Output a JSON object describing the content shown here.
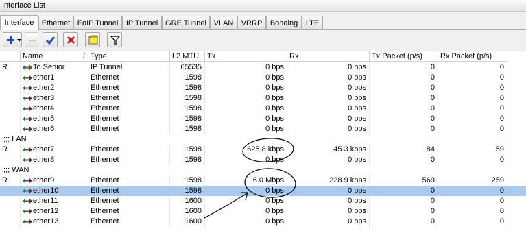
{
  "window": {
    "title": "Interface List"
  },
  "tabs": [
    "Interface",
    "Ethernet",
    "EoIP Tunnel",
    "IP Tunnel",
    "GRE Tunnel",
    "VLAN",
    "VRRP",
    "Bonding",
    "LTE"
  ],
  "toolbar": {
    "add_icon": "plus-icon",
    "remove_icon": "minus-icon",
    "enable_icon": "check-icon",
    "disable_icon": "x-icon",
    "comment_icon": "note-icon",
    "filter_icon": "filter-icon"
  },
  "columns": {
    "flag": "",
    "name": "Name",
    "sort_mark": "/",
    "type": "Type",
    "mtu": "L2 MTU",
    "tx": "Tx",
    "rx": "Rx",
    "txp": "Tx Packet (p/s)",
    "rxp": "Rx Packet (p/s)"
  },
  "rows": {
    "to_senior": {
      "flag": "R",
      "name": "To Senior",
      "type": "IP Tunnel",
      "mtu": "65535",
      "tx": "0 bps",
      "rx": "0 bps",
      "txp": "0",
      "rxp": "0"
    },
    "ether1": {
      "flag": "",
      "name": "ether1",
      "type": "Ethernet",
      "mtu": "1598",
      "tx": "0 bps",
      "rx": "0 bps",
      "txp": "0",
      "rxp": "0"
    },
    "ether2": {
      "flag": "",
      "name": "ether2",
      "type": "Ethernet",
      "mtu": "1598",
      "tx": "0 bps",
      "rx": "0 bps",
      "txp": "0",
      "rxp": "0"
    },
    "ether3": {
      "flag": "",
      "name": "ether3",
      "type": "Ethernet",
      "mtu": "1598",
      "tx": "0 bps",
      "rx": "0 bps",
      "txp": "0",
      "rxp": "0"
    },
    "ether4": {
      "flag": "",
      "name": "ether4",
      "type": "Ethernet",
      "mtu": "1598",
      "tx": "0 bps",
      "rx": "0 bps",
      "txp": "0",
      "rxp": "0"
    },
    "ether5": {
      "flag": "",
      "name": "ether5",
      "type": "Ethernet",
      "mtu": "1598",
      "tx": "0 bps",
      "rx": "0 bps",
      "txp": "0",
      "rxp": "0"
    },
    "ether6": {
      "flag": "",
      "name": "ether6",
      "type": "Ethernet",
      "mtu": "1598",
      "tx": "0 bps",
      "rx": "0 bps",
      "txp": "0",
      "rxp": "0"
    },
    "lan_label": ";;; LAN",
    "ether7": {
      "flag": "R",
      "name": "ether7",
      "type": "Ethernet",
      "mtu": "1598",
      "tx": "625.8 kbps",
      "rx": "45.3 kbps",
      "txp": "84",
      "rxp": "59"
    },
    "ether8": {
      "flag": "",
      "name": "ether8",
      "type": "Ethernet",
      "mtu": "1598",
      "tx": "0 bps",
      "rx": "0 bps",
      "txp": "0",
      "rxp": "0"
    },
    "wan_label": ";;; WAN",
    "ether9": {
      "flag": "R",
      "name": "ether9",
      "type": "Ethernet",
      "mtu": "1598",
      "tx": "6.0 Mbps",
      "rx": "228.9 kbps",
      "txp": "569",
      "rxp": "259"
    },
    "ether10": {
      "flag": "",
      "name": "ether10",
      "type": "Ethernet",
      "mtu": "1598",
      "tx": "0 bps",
      "rx": "0 bps",
      "txp": "0",
      "rxp": "0"
    },
    "ether11": {
      "flag": "",
      "name": "ether11",
      "type": "Ethernet",
      "mtu": "1600",
      "tx": "0 bps",
      "rx": "0 bps",
      "txp": "0",
      "rxp": "0"
    },
    "ether12": {
      "flag": "",
      "name": "ether12",
      "type": "Ethernet",
      "mtu": "1600",
      "tx": "0 bps",
      "rx": "0 bps",
      "txp": "0",
      "rxp": "0"
    },
    "ether13": {
      "flag": "",
      "name": "ether13",
      "type": "Ethernet",
      "mtu": "1600",
      "tx": "0 bps",
      "rx": "0 bps",
      "txp": "0",
      "rxp": "0"
    }
  },
  "colors": {
    "selected_row": "#aac9ee",
    "plus_icon": "#1f4fbf",
    "remove_icon": "#d01818",
    "check_icon": "#1f4fbf",
    "annotation_ink": "#111111"
  }
}
